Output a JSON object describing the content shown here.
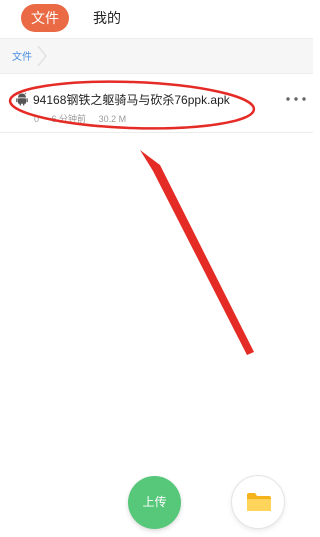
{
  "tabs": [
    {
      "label": "文件",
      "active": true
    },
    {
      "label": "我的",
      "active": false
    }
  ],
  "breadcrumb": {
    "label": "文件"
  },
  "files": [
    {
      "name": "94168钢铁之躯骑马与砍杀76ppk.apk",
      "count": "0",
      "time": "6 分钟前",
      "size": "30.2 M",
      "icon": "android-icon"
    }
  ],
  "actions": {
    "upload_label": "上传",
    "folder_icon": "folder-icon"
  },
  "colors": {
    "accent": "#e96a45",
    "link": "#4a8fe3",
    "upload": "#57c77a",
    "annotation": "#e52b25"
  }
}
